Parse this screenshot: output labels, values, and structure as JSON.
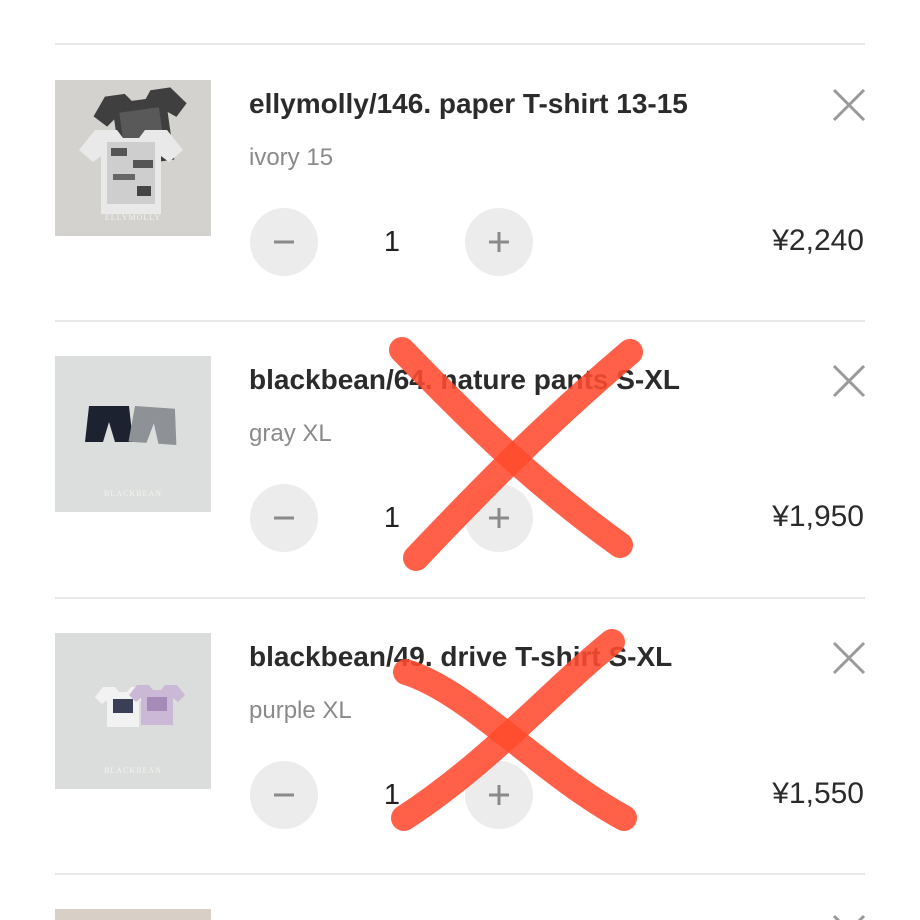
{
  "cart": {
    "items": [
      {
        "title": "ellymolly/146. paper T-shirt 13-15",
        "variant": "ivory 15",
        "quantity": "1",
        "price": "¥2,240",
        "thumb_label": "ELLYMOLLY",
        "crossed_out": false
      },
      {
        "title": "blackbean/64. nature pants S-XL",
        "variant": "gray XL",
        "quantity": "1",
        "price": "¥1,950",
        "thumb_label": "BLACKBEAN",
        "crossed_out": true
      },
      {
        "title": "blackbean/49. drive T-shirt S-XL",
        "variant": "purple XL",
        "quantity": "1",
        "price": "¥1,550",
        "thumb_label": "BLACKBEAN",
        "crossed_out": true
      }
    ]
  },
  "icons": {
    "remove": "close-icon",
    "decrease": "minus-icon",
    "increase": "plus-icon"
  },
  "colors": {
    "cross_mark": "#ff4a2e",
    "stepper_bg": "#ececec",
    "variant_text": "#8a8a8a"
  }
}
